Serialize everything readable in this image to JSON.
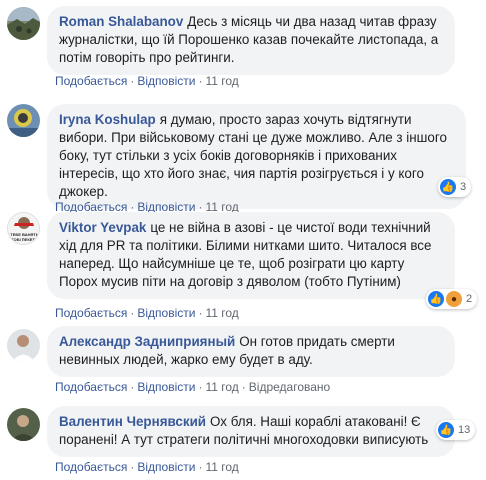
{
  "action_labels": {
    "like": "Подобається",
    "reply": "Відповісти",
    "edited": "Відредаговано"
  },
  "comments": [
    {
      "author": "Roman Shalabanov",
      "text": "Десь з місяць чи два назад читав фразу журналістки, що їй Порошенко казав почекайте листопада, а потім говоріть про рейтинги.",
      "time": "11 год"
    },
    {
      "author": "Iryna Koshulap",
      "text": "я думаю, просто зараз хочуть відтягнути вибори. При військовому стані це дуже можливо. Але з іншого боку, тут стільки з усіх боків договорняків і прихованих інтересів, що хто його знає, чия партія розігрується і у кого джокер.",
      "time": "11 год",
      "reactions": {
        "icons": [
          "like-icon"
        ],
        "count": "3"
      }
    },
    {
      "author": "Viktor Yevpak",
      "text": "це не війна в азові - це чистої води технічний хід для PR та політики. Білими нитками шито. Читалося все наперед. Що найсумніше це те, щоб розіграти цю карту Порох мусив піти на договір з дяволом (тобто Путіним)",
      "time": "11 год",
      "avatar_caption": "ТЕБЕ ВАНЯТЬ ТОБІ ПЕКЕТЬ",
      "reactions": {
        "icons": [
          "like-icon",
          "angry-icon"
        ],
        "count": "2"
      }
    },
    {
      "author": "Александр Задниприяный",
      "text": "Он готов придать смерти невинных людей, жарко ему будет в аду.",
      "time": "11 год",
      "edited": true
    },
    {
      "author": "Валентин Чернявский",
      "text": "Ох бля. Наші кораблі атаковані! Є поранені! А тут стратеги політичні многоходовки виписують",
      "time": "11 год",
      "reactions": {
        "icons": [
          "like-icon"
        ],
        "count": "13"
      }
    }
  ],
  "colors": {
    "author": "#385898",
    "bubble": "#f2f3f5",
    "like": "#1877f2"
  }
}
